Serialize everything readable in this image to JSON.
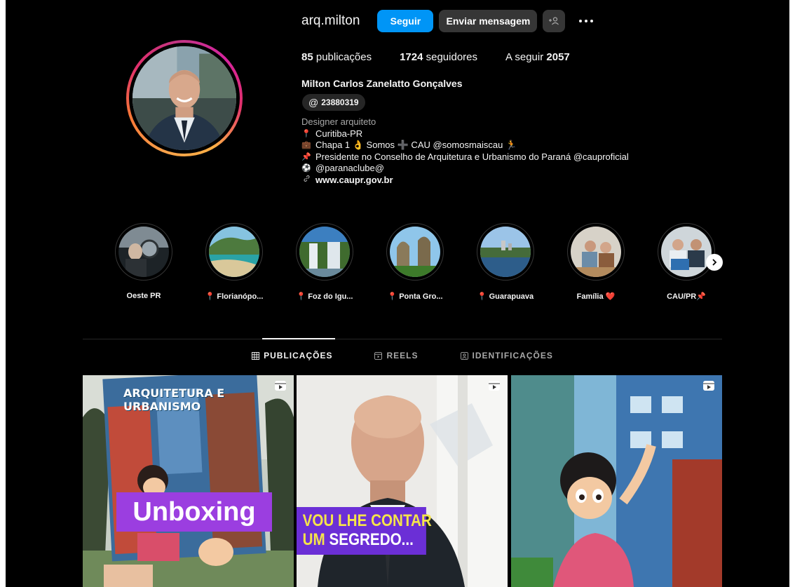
{
  "profile": {
    "username": "arq.milton",
    "follow_label": "Seguir",
    "message_label": "Enviar mensagem",
    "more_icon": "more-horizontal-icon",
    "suggest_icon": "add-person-icon"
  },
  "stats": {
    "posts_count": "85",
    "posts_label": "publicações",
    "followers_count": "1724",
    "followers_label": "seguidores",
    "following_label": "A seguir",
    "following_count": "2057"
  },
  "full_name": "Milton Carlos Zanelatto Gonçalves",
  "threads": {
    "icon": "threads-icon",
    "handle": "23880319"
  },
  "bio": {
    "category": "Designer arquiteto",
    "lines": [
      {
        "emoji": "📍",
        "text": "Curitiba-PR"
      },
      {
        "emoji": "💼",
        "text": "Chapa 1 👌 Somos ➕ CAU @somosmaiscau 🏃"
      },
      {
        "emoji": "📌",
        "text": "Presidente no Conselho de Arquitetura e Urbanismo do Paraná @cauproficial"
      },
      {
        "emoji": "⚽",
        "text": "@paranaclube@"
      }
    ],
    "link": "www.caupr.gov.br",
    "link_icon": "link-icon"
  },
  "highlights": [
    {
      "label": "Oeste PR"
    },
    {
      "label": "📍 Florianópo..."
    },
    {
      "label": "📍 Foz do Igu..."
    },
    {
      "label": "📍 Ponta Gro..."
    },
    {
      "label": "📍 Guarapuava"
    },
    {
      "label": "Família ❤️"
    },
    {
      "label": "CAU/PR📌"
    }
  ],
  "tabs": [
    {
      "label": "PUBLICAÇÕES",
      "icon": "grid-icon",
      "active": true
    },
    {
      "label": "REELS",
      "icon": "reels-icon",
      "active": false
    },
    {
      "label": "IDENTIFICAÇÕES",
      "icon": "tagged-icon",
      "active": false
    }
  ],
  "posts": [
    {
      "overlay": "Unboxing",
      "comic_title": "ARQUITETURA E URBANISMO",
      "badge": "reel-icon"
    },
    {
      "overlay_line1": "VOU LHE CONTAR",
      "overlay_line2a": "UM ",
      "overlay_line2b": "SEGREDO...",
      "badge": "reel-icon"
    },
    {
      "badge": "reel-icon"
    }
  ],
  "colors": {
    "background": "#000000",
    "primary_button": "#0095f6",
    "secondary_button": "#363636",
    "text": "#f5f5f5",
    "muted_text": "#a8a8a8"
  }
}
